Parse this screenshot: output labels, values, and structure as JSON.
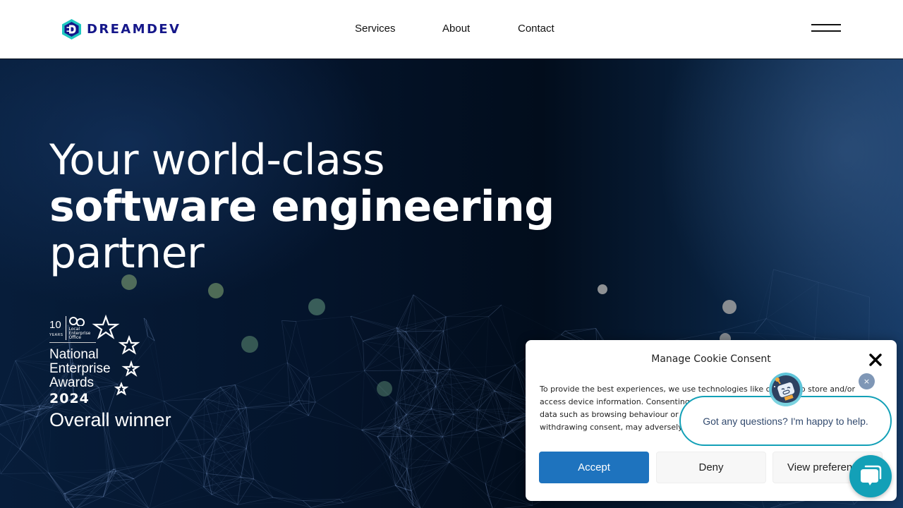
{
  "header": {
    "logo_text": "DREAMDEV",
    "nav": [
      {
        "label": "Services"
      },
      {
        "label": "About"
      },
      {
        "label": "Contact"
      }
    ],
    "menu_icon": "hamburger-menu-icon"
  },
  "hero": {
    "title_line1": "Your world-class",
    "title_line2": "software engineering",
    "title_line3": "partner"
  },
  "award": {
    "ten": "10",
    "years": "YEARS",
    "leo_line1": "Local",
    "leo_line2": "Enterprise",
    "leo_line3": "Office",
    "name_line1": "National",
    "name_line2": "Enterprise",
    "name_line3": "Awards",
    "year": "2024",
    "result": "Overall winner"
  },
  "cookie": {
    "title": "Manage Cookie Consent",
    "text_line1": "To provide the best experiences, we use technologies like cookies to store and/or",
    "text_line2": "access device information. Consenting",
    "text_line3": "data such as browsing behaviour or",
    "text_line4": "withdrawing consent, may adversely",
    "accept": "Accept",
    "deny": "Deny",
    "preferences": "View preferences"
  },
  "chat": {
    "message": "Got any questions? I'm happy to help.",
    "dismiss": "×"
  },
  "colors": {
    "brand": "#15178a",
    "logo_teal": "#1fc7c0",
    "accept": "#1e73be",
    "chat": "#13a0b7"
  }
}
